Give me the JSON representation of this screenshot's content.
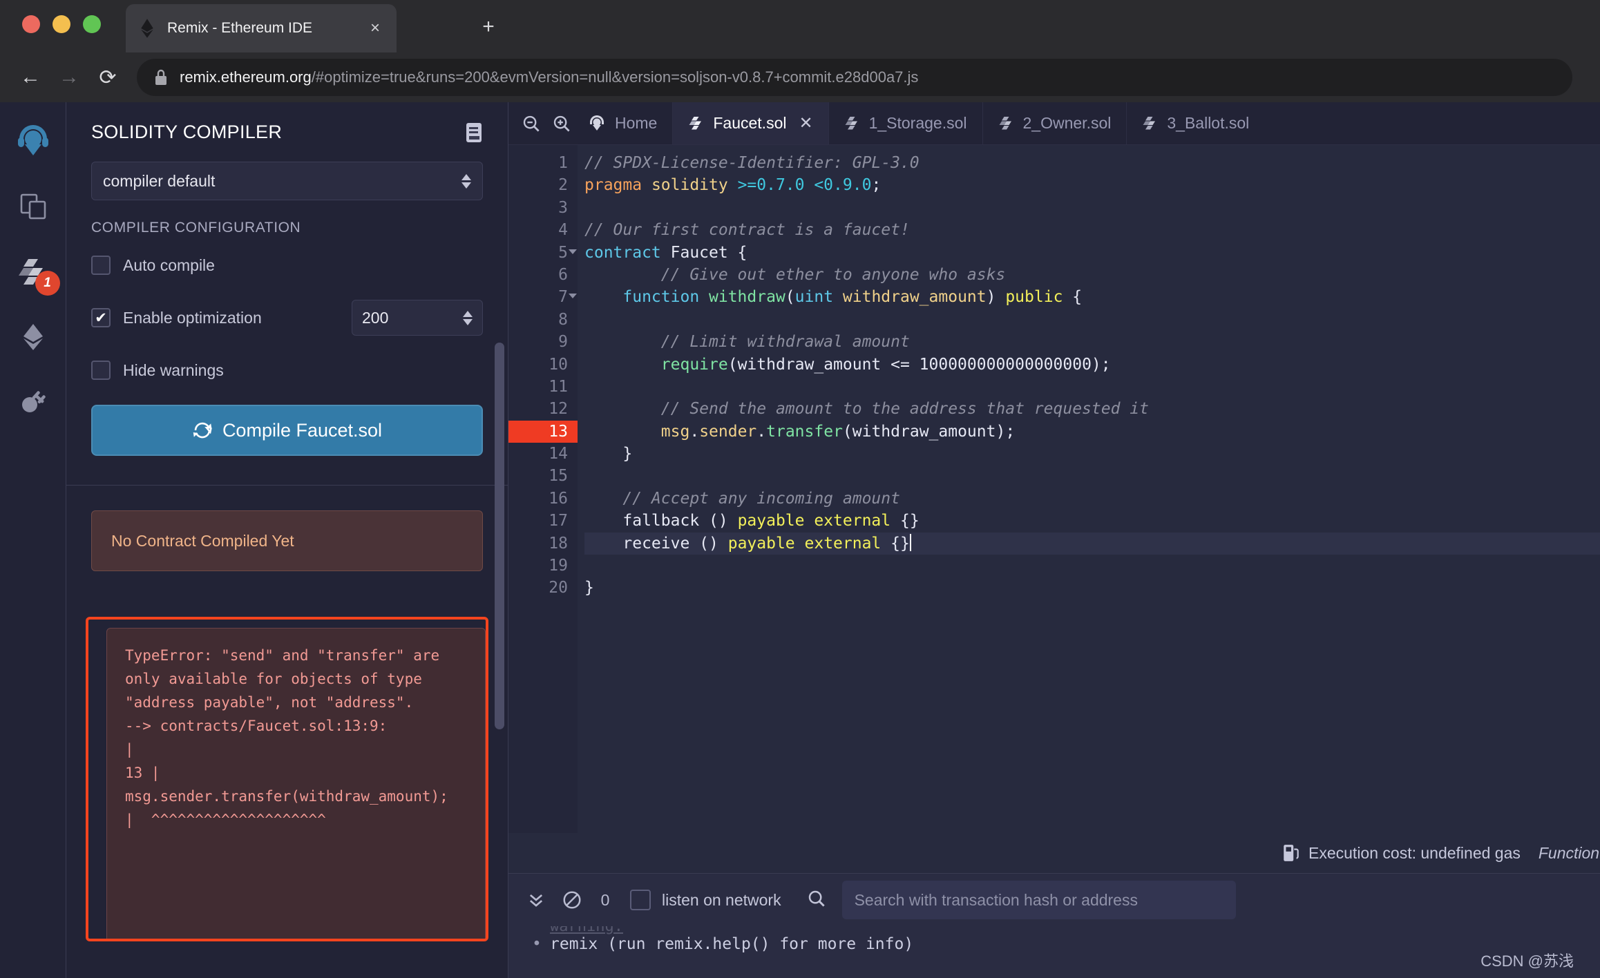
{
  "browser": {
    "tab_title": "Remix - Ethereum IDE",
    "tab_favicon_name": "ethereum-logo-icon",
    "close_label": "×",
    "new_tab_label": "+",
    "back_label": "←",
    "forward_label": "→",
    "reload_label": "⟳",
    "url_host": "remix.ethereum.org",
    "url_rest": "/#optimize=true&runs=200&evmVersion=null&version=soljson-v0.8.7+commit.e28d00a7.js",
    "full_url": "remix.ethereum.org/#optimize=true&runs=200&evmVersion=null&version=soljson-v0.8.7+commit.e28d00a7.js"
  },
  "rail": {
    "items": [
      {
        "name": "remix-home-logo-icon",
        "label": "Remix"
      },
      {
        "name": "file-explorer-icon",
        "label": "File explorers"
      },
      {
        "name": "solidity-compiler-icon",
        "label": "Solidity compiler",
        "badge": "1"
      },
      {
        "name": "deploy-run-icon",
        "label": "Deploy & run transactions"
      },
      {
        "name": "plugin-manager-icon",
        "label": "Plugin manager"
      }
    ]
  },
  "panel": {
    "title": "SOLIDITY COMPILER",
    "doc_icon": "documentation-icon",
    "compiler_select_value": "compiler default",
    "config_heading": "COMPILER CONFIGURATION",
    "auto_compile_label": "Auto compile",
    "auto_compile_checked": false,
    "enable_optimization_label": "Enable optimization",
    "enable_optimization_checked": true,
    "runs_value": "200",
    "hide_warnings_label": "Hide warnings",
    "hide_warnings_checked": false,
    "compile_button_label": "Compile Faucet.sol",
    "compile_button_icon": "refresh-icon",
    "compile_button_color": "#337ba8",
    "no_contract_text": "No Contract Compiled Yet",
    "no_contract_color": "#f0b489",
    "error_highlight_color": "#f4441e",
    "error_text": "TypeError: \"send\" and \"transfer\" are only available for objects of type \"address payable\", not \"address\".\n--> contracts/Faucet.sol:13:9:\n|\n13 | msg.sender.transfer(withdraw_amount);\n|  ^^^^^^^^^^^^^^^^^^^^"
  },
  "editor": {
    "zoom_out_icon": "zoom-out-icon",
    "zoom_in_icon": "zoom-in-icon",
    "home_tab_label": "Home",
    "home_tab_icon": "remix-logo-icon",
    "tabs": [
      {
        "label": "Faucet.sol",
        "active": true,
        "icon": "solidity-file-icon",
        "close": "✕"
      },
      {
        "label": "1_Storage.sol",
        "active": false,
        "icon": "solidity-file-icon"
      },
      {
        "label": "2_Owner.sol",
        "active": false,
        "icon": "solidity-file-icon"
      },
      {
        "label": "3_Ballot.sol",
        "active": false,
        "icon": "solidity-file-icon"
      }
    ],
    "error_line": 13,
    "current_line": 18,
    "total_lines": 20,
    "lines": [
      {
        "n": 1,
        "fold": false,
        "tokens": [
          {
            "t": "c-comment",
            "v": "// SPDX-License-Identifier: GPL-3.0"
          }
        ]
      },
      {
        "n": 2,
        "fold": false,
        "tokens": [
          {
            "t": "c-key",
            "v": "pragma "
          },
          {
            "t": "c-param",
            "v": "solidity "
          },
          {
            "t": "c-num",
            "v": ">=0.7.0 <0.9.0"
          },
          {
            "t": "c-plain",
            "v": ";"
          }
        ]
      },
      {
        "n": 3,
        "fold": false,
        "tokens": []
      },
      {
        "n": 4,
        "fold": false,
        "tokens": [
          {
            "t": "c-comment",
            "v": "// Our first contract is a faucet!"
          }
        ]
      },
      {
        "n": 5,
        "fold": true,
        "tokens": [
          {
            "t": "c-type",
            "v": "contract "
          },
          {
            "t": "c-plain",
            "v": "Faucet {"
          }
        ]
      },
      {
        "n": 6,
        "fold": false,
        "tokens": [
          {
            "t": "c-comment",
            "v": "        // Give out ether to anyone who asks"
          }
        ]
      },
      {
        "n": 7,
        "fold": true,
        "tokens": [
          {
            "t": "c-type",
            "v": "    function "
          },
          {
            "t": "c-fn",
            "v": "withdraw"
          },
          {
            "t": "c-plain",
            "v": "("
          },
          {
            "t": "c-type",
            "v": "uint "
          },
          {
            "t": "c-param",
            "v": "withdraw_amount"
          },
          {
            "t": "c-plain",
            "v": ") "
          },
          {
            "t": "c-mod",
            "v": "public "
          },
          {
            "t": "c-plain",
            "v": "{"
          }
        ]
      },
      {
        "n": 8,
        "fold": false,
        "tokens": []
      },
      {
        "n": 9,
        "fold": false,
        "tokens": [
          {
            "t": "c-comment",
            "v": "        // Limit withdrawal amount"
          }
        ]
      },
      {
        "n": 10,
        "fold": false,
        "tokens": [
          {
            "t": "c-fn",
            "v": "        require"
          },
          {
            "t": "c-plain",
            "v": "(withdraw_amount <= "
          },
          {
            "t": "c-plain",
            "v": "100000000000000000"
          },
          {
            "t": "c-plain",
            "v": ");"
          }
        ]
      },
      {
        "n": 11,
        "fold": false,
        "tokens": []
      },
      {
        "n": 12,
        "fold": false,
        "tokens": [
          {
            "t": "c-comment",
            "v": "        // Send the amount to the address that requested it"
          }
        ]
      },
      {
        "n": 13,
        "fold": false,
        "tokens": [
          {
            "t": "c-ident",
            "v": "        msg"
          },
          {
            "t": "c-plain",
            "v": "."
          },
          {
            "t": "c-ident",
            "v": "sender"
          },
          {
            "t": "c-plain",
            "v": "."
          },
          {
            "t": "c-fn",
            "v": "transfer"
          },
          {
            "t": "c-plain",
            "v": "(withdraw_amount);"
          }
        ]
      },
      {
        "n": 14,
        "fold": false,
        "tokens": [
          {
            "t": "c-plain",
            "v": "    }"
          }
        ]
      },
      {
        "n": 15,
        "fold": false,
        "tokens": []
      },
      {
        "n": 16,
        "fold": false,
        "tokens": [
          {
            "t": "c-comment",
            "v": "    // Accept any incoming amount"
          }
        ]
      },
      {
        "n": 17,
        "fold": false,
        "tokens": [
          {
            "t": "c-plain",
            "v": "    fallback () "
          },
          {
            "t": "c-mod",
            "v": "payable external "
          },
          {
            "t": "c-plain",
            "v": "{}"
          }
        ]
      },
      {
        "n": 18,
        "fold": false,
        "tokens": [
          {
            "t": "c-plain",
            "v": "    receive () "
          },
          {
            "t": "c-mod",
            "v": "payable external "
          },
          {
            "t": "c-plain",
            "v": "{}"
          }
        ]
      },
      {
        "n": 19,
        "fold": false,
        "tokens": []
      },
      {
        "n": 20,
        "fold": false,
        "tokens": [
          {
            "t": "c-plain",
            "v": "}"
          }
        ]
      }
    ],
    "code_text": "// SPDX-License-Identifier: GPL-3.0\npragma solidity >=0.7.0 <0.9.0;\n\n// Our first contract is a faucet!\ncontract Faucet {\n        // Give out ether to anyone who asks\n    function withdraw(uint withdraw_amount) public {\n\n        // Limit withdrawal amount\n        require(withdraw_amount <= 100000000000000000);\n\n        // Send the amount to the address that requested it\n        msg.sender.transfer(withdraw_amount);\n    }\n\n    // Accept any incoming amount\n    fallback () payable external {}\n    receive () payable external {}\n\n}"
  },
  "status": {
    "gas_icon": "gas-pump-icon",
    "execution_cost": "Execution cost: undefined gas",
    "node_type": "FunctionDefi"
  },
  "terminal": {
    "collapse_icon": "double-chevron-down-icon",
    "clear_icon": "ban-icon",
    "pending_count": "0",
    "listen_label": "listen on network",
    "listen_checked": false,
    "search_icon": "search-icon",
    "search_placeholder": "Search with transaction hash or address",
    "faint_line": "warning:",
    "log_line": "remix (run remix.help() for more info)",
    "watermark": "CSDN @苏浅"
  }
}
